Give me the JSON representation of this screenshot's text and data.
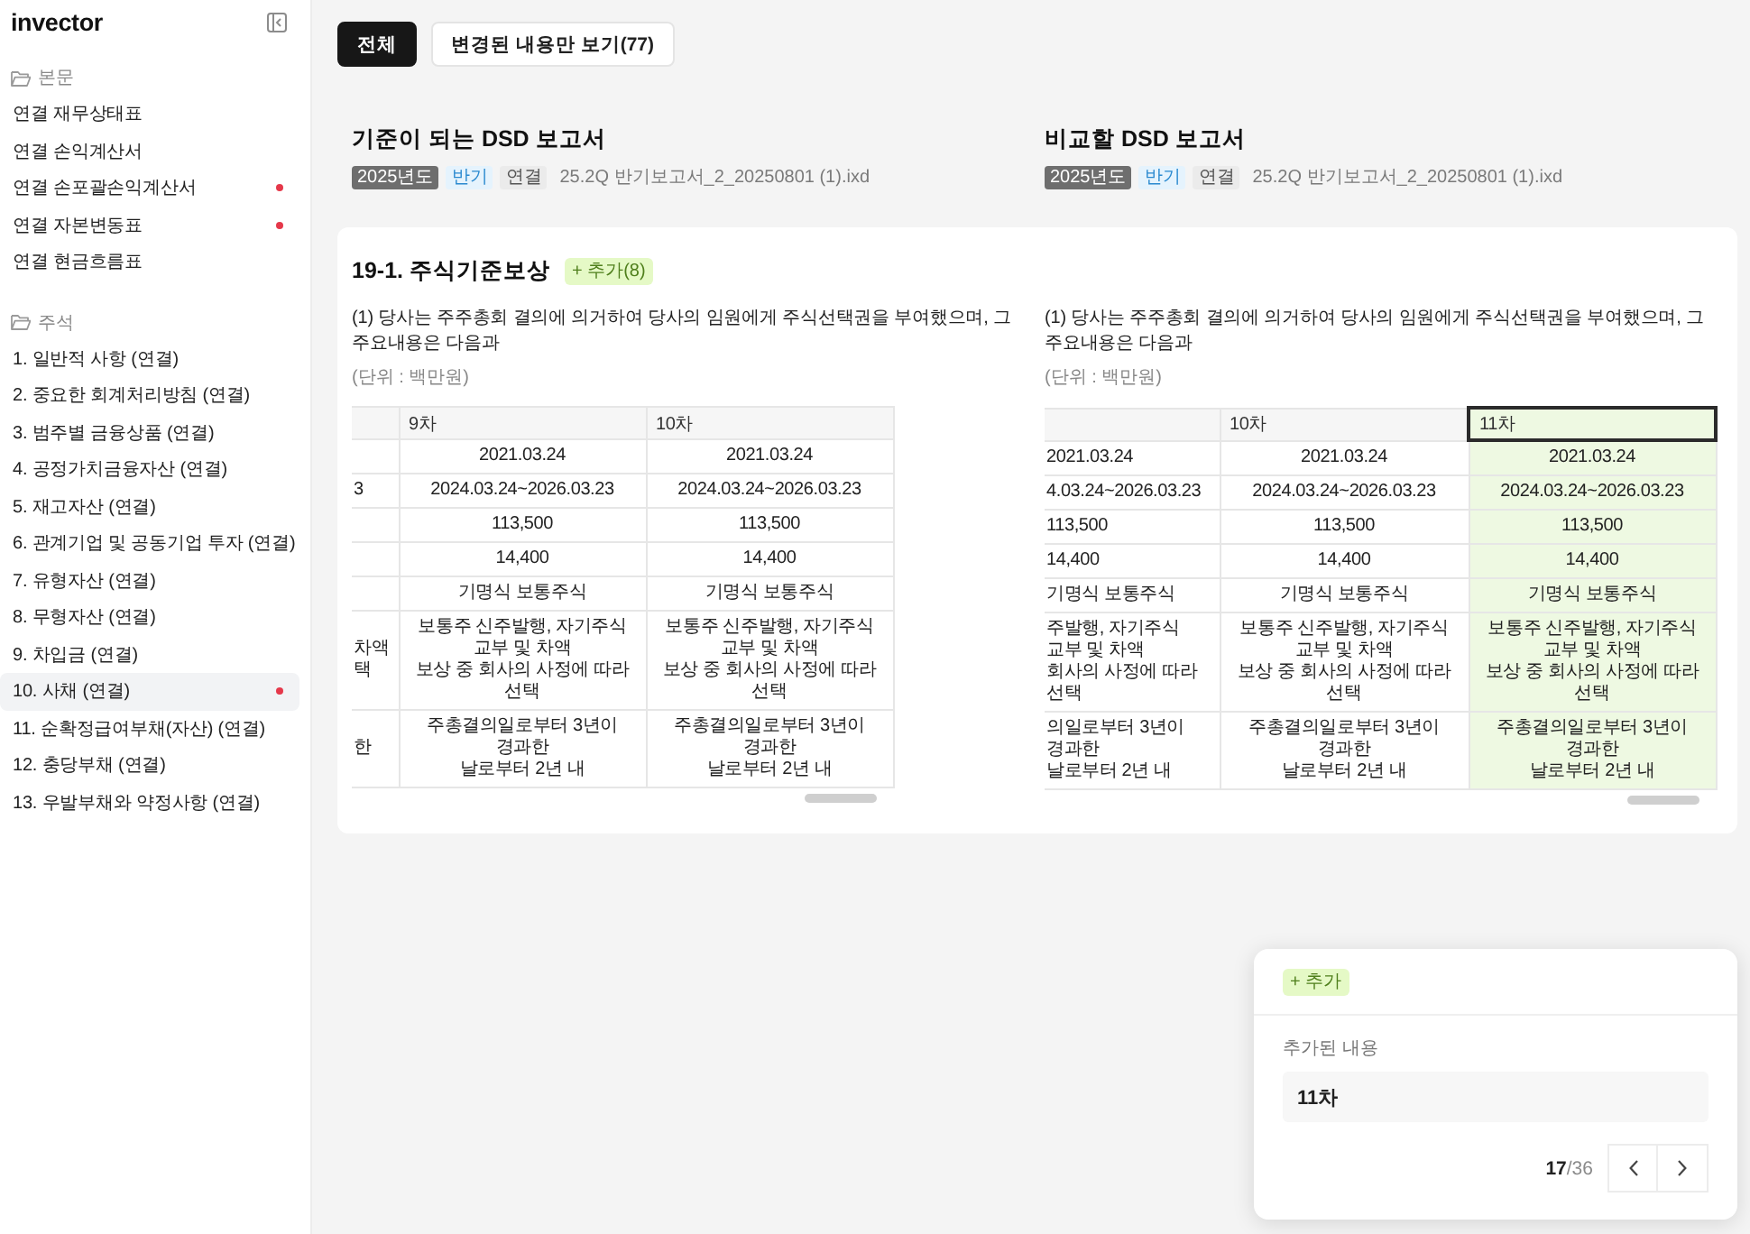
{
  "sidebar": {
    "logo": "invector",
    "sections": [
      {
        "title": "본문",
        "items": [
          {
            "label": "연결 재무상태표",
            "selected": false,
            "changed": false
          },
          {
            "label": "연결 손익계산서",
            "selected": false,
            "changed": false
          },
          {
            "label": "연결 손포괄손익계산서",
            "selected": false,
            "changed": true
          },
          {
            "label": "연결 자본변동표",
            "selected": false,
            "changed": true
          },
          {
            "label": "연결 현금흐름표",
            "selected": false,
            "changed": false
          }
        ]
      },
      {
        "title": "주석",
        "items": [
          {
            "label": "1. 일반적 사항 (연결)",
            "selected": false,
            "changed": false
          },
          {
            "label": "2. 중요한 회계처리방침 (연결)",
            "selected": false,
            "changed": false
          },
          {
            "label": "3. 범주별 금융상품 (연결)",
            "selected": false,
            "changed": false
          },
          {
            "label": "4. 공정가치금융자산 (연결)",
            "selected": false,
            "changed": false
          },
          {
            "label": "5. 재고자산 (연결)",
            "selected": false,
            "changed": false
          },
          {
            "label": "6. 관계기업 및 공동기업 투자 (연결)",
            "selected": false,
            "changed": false
          },
          {
            "label": "7. 유형자산 (연결)",
            "selected": false,
            "changed": false
          },
          {
            "label": "8. 무형자산 (연결)",
            "selected": false,
            "changed": false
          },
          {
            "label": "9. 차입금 (연결)",
            "selected": false,
            "changed": false
          },
          {
            "label": "10. 사채 (연결)",
            "selected": true,
            "changed": true
          },
          {
            "label": "11. 순확정급여부채(자산) (연결)",
            "selected": false,
            "changed": false
          },
          {
            "label": "12. 충당부채 (연결)",
            "selected": false,
            "changed": false
          },
          {
            "label": "13. 우발부채와 약정사항 (연결)",
            "selected": false,
            "changed": false
          }
        ]
      }
    ]
  },
  "filter_tabs": [
    {
      "label": "전체",
      "selected": true
    },
    {
      "label": "변경된 내용만 보기(77)",
      "selected": false
    }
  ],
  "reports": [
    {
      "heading": "기준이 되는 DSD 보고서",
      "tags": [
        {
          "label": "2025년도",
          "kind": "year"
        },
        {
          "label": "반기",
          "kind": "period"
        },
        {
          "label": "연결",
          "kind": "scope"
        }
      ],
      "file": "25.2Q 반기보고서_2_20250801 (1).ixd"
    },
    {
      "heading": "비교할 DSD 보고서",
      "tags": [
        {
          "label": "2025년도",
          "kind": "year"
        },
        {
          "label": "반기",
          "kind": "period"
        },
        {
          "label": "연결",
          "kind": "scope"
        }
      ],
      "file": "25.2Q 반기보고서_2_20250801 (1).ixd"
    }
  ],
  "note": {
    "title": "19-1. 주식기준보상",
    "badge": "+ 추가(8)",
    "panes": [
      {
        "paragraph": "(1) 당사는 주주총회 결의에 의거하여 당사의 임원에게 주식선택권을 부여했으며, 그 주요내용은 다음과",
        "unit": "(단위 : 백만원)",
        "table": {
          "columns": [
            {
              "added": false,
              "selected": false
            },
            {
              "header": "9차",
              "added": false,
              "selected": false
            },
            {
              "header": "10차",
              "added": false,
              "selected": false
            }
          ],
          "rows": [
            [
              null,
              [
                "2021.03.24"
              ],
              [
                "2021.03.24"
              ]
            ],
            [
              [
                "3"
              ],
              [
                "2024.03.24~2026.03.23"
              ],
              [
                "2024.03.24~2026.03.23"
              ]
            ],
            [
              null,
              [
                "113,500"
              ],
              [
                "113,500"
              ]
            ],
            [
              null,
              [
                "14,400"
              ],
              [
                "14,400"
              ]
            ],
            [
              null,
              [
                "기명식 보통주식"
              ],
              [
                "기명식 보통주식"
              ]
            ],
            [
              [
                "차액",
                "택"
              ],
              [
                "보통주 신주발행, 자기주식 교부 및 차액",
                "보상 중 회사의 사정에 따라 선택"
              ],
              [
                "보통주 신주발행, 자기주식 교부 및 차액",
                "보상 중 회사의 사정에 따라 선택"
              ]
            ],
            [
              [
                "한"
              ],
              [
                "주총결의일로부터 3년이 경과한",
                "날로부터 2년 내"
              ],
              [
                "주총결의일로부터 3년이 경과한",
                "날로부터 2년 내"
              ]
            ]
          ]
        }
      },
      {
        "paragraph": "(1) 당사는 주주총회 결의에 의거하여 당사의 임원에게 주식선택권을 부여했으며, 그 주요내용은 다음과",
        "unit": "(단위 : 백만원)",
        "table": {
          "columns": [
            {
              "added": false,
              "selected": false
            },
            {
              "header": "10차",
              "added": false,
              "selected": false
            },
            {
              "header": "11차",
              "added": true,
              "selected": true
            }
          ],
          "rows": [
            [
              [
                "2021.03.24"
              ],
              [
                "2021.03.24"
              ],
              [
                "2021.03.24"
              ]
            ],
            [
              [
                "4.03.24~2026.03.23"
              ],
              [
                "2024.03.24~2026.03.23"
              ],
              [
                "2024.03.24~2026.03.23"
              ]
            ],
            [
              [
                "113,500"
              ],
              [
                "113,500"
              ],
              [
                "113,500"
              ]
            ],
            [
              [
                "14,400"
              ],
              [
                "14,400"
              ],
              [
                "14,400"
              ]
            ],
            [
              [
                "기명식 보통주식"
              ],
              [
                "기명식 보통주식"
              ],
              [
                "기명식 보통주식"
              ]
            ],
            [
              [
                "주발행, 자기주식 교부 및 차액",
                "회사의 사정에 따라 선택"
              ],
              [
                "보통주 신주발행, 자기주식 교부 및 차액",
                "보상 중 회사의 사정에 따라 선택"
              ],
              [
                "보통주 신주발행, 자기주식 교부 및 차액",
                "보상 중 회사의 사정에 따라 선택"
              ]
            ],
            [
              [
                "의일로부터 3년이 경과한",
                "날로부터 2년 내"
              ],
              [
                "주총결의일로부터 3년이 경과한",
                "날로부터 2년 내"
              ],
              [
                "주총결의일로부터 3년이 경과한",
                "날로부터 2년 내"
              ]
            ]
          ]
        }
      }
    ]
  },
  "popup": {
    "badge": "+ 추가",
    "label": "추가된 내용",
    "value": "11차",
    "pager": "**17**/36"
  }
}
